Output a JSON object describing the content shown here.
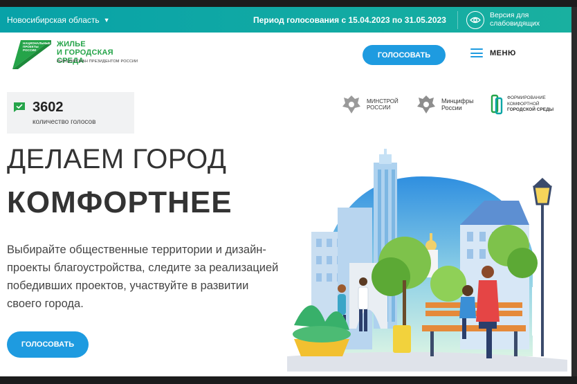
{
  "topbar": {
    "region": "Новосибирская область",
    "period": "Период голосования с 15.04.2023 по 31.05.2023",
    "low_vision_label": "Версия для слабовидящих"
  },
  "header": {
    "logo": {
      "badge_text": "НАЦИОНАЛЬНЫЕ ПРОЕКТЫ РОССИИ",
      "title_line1": "ЖИЛЬЕ",
      "title_line2": "И ГОРОДСКАЯ СРЕДА",
      "subtitle": "ИНИЦИИРОВАН ПРЕЗИДЕНТОМ РОССИИ"
    },
    "vote_button": "ГОЛОСОВАТЬ",
    "menu_label": "МЕНЮ"
  },
  "counter": {
    "value": "3602",
    "label": "количество голосов"
  },
  "partners": [
    {
      "line1": "МИНСТРОЙ",
      "line2": "РОССИИ"
    },
    {
      "line1": "Минцифры",
      "line2": "России"
    },
    {
      "line1": "ФОРМИРОВАНИЕ",
      "line2": "КОМФОРТНОЙ",
      "line3": "ГОРОДСКОЙ СРЕДЫ"
    }
  ],
  "hero": {
    "title_line1": "ДЕЛАЕМ ГОРОД",
    "title_line2": "КОМФОРТНЕЕ",
    "description": "Выбирайте общественные территории и дизайн-проекты благоустройства, следите за реализацией победивших проектов, участвуйте в развитии своего города.",
    "vote_button": "ГОЛОСОВАТЬ"
  },
  "colors": {
    "topbar": "#0ba5a5",
    "accent_blue": "#1e9be0",
    "brand_green": "#25a449",
    "text_dark": "#333333"
  },
  "icons": {
    "region_caret": "chevron-down-icon",
    "low_vision": "eye-icon",
    "menu": "hamburger-icon",
    "counter": "check-message-icon"
  }
}
